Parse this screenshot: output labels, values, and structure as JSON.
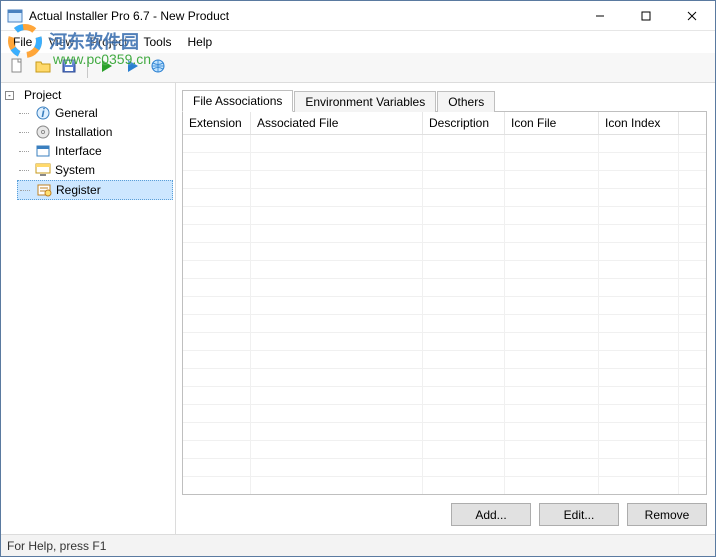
{
  "title": "Actual Installer Pro 6.7 - New Product",
  "menubar": [
    "File",
    "View",
    "Project",
    "Tools",
    "Help"
  ],
  "toolbar_icons": [
    "new-file-icon",
    "open-folder-icon",
    "save-icon",
    "sep",
    "play-green-icon",
    "play-blue-icon",
    "globe-icon"
  ],
  "tree": {
    "root": "Project",
    "toggle": "-",
    "items": [
      {
        "label": "General",
        "icon": "info-icon"
      },
      {
        "label": "Installation",
        "icon": "disc-icon"
      },
      {
        "label": "Interface",
        "icon": "window-icon"
      },
      {
        "label": "System",
        "icon": "system-icon"
      },
      {
        "label": "Register",
        "icon": "register-icon"
      }
    ],
    "selected_index": 4
  },
  "tabs": [
    {
      "label": "File Associations",
      "active": true
    },
    {
      "label": "Environment Variables",
      "active": false
    },
    {
      "label": "Others",
      "active": false
    }
  ],
  "columns": [
    {
      "label": "Extension",
      "class": "col-ext"
    },
    {
      "label": "Associated File",
      "class": "col-file"
    },
    {
      "label": "Description",
      "class": "col-desc"
    },
    {
      "label": "Icon File",
      "class": "col-icon"
    },
    {
      "label": "Icon Index",
      "class": "col-idx"
    }
  ],
  "rows": [],
  "empty_row_count": 22,
  "buttons": {
    "add": "Add...",
    "edit": "Edit...",
    "remove": "Remove"
  },
  "statusbar": "For Help, press F1",
  "watermark": {
    "text": "河东软件园",
    "url": "www.pc0359.cn"
  }
}
